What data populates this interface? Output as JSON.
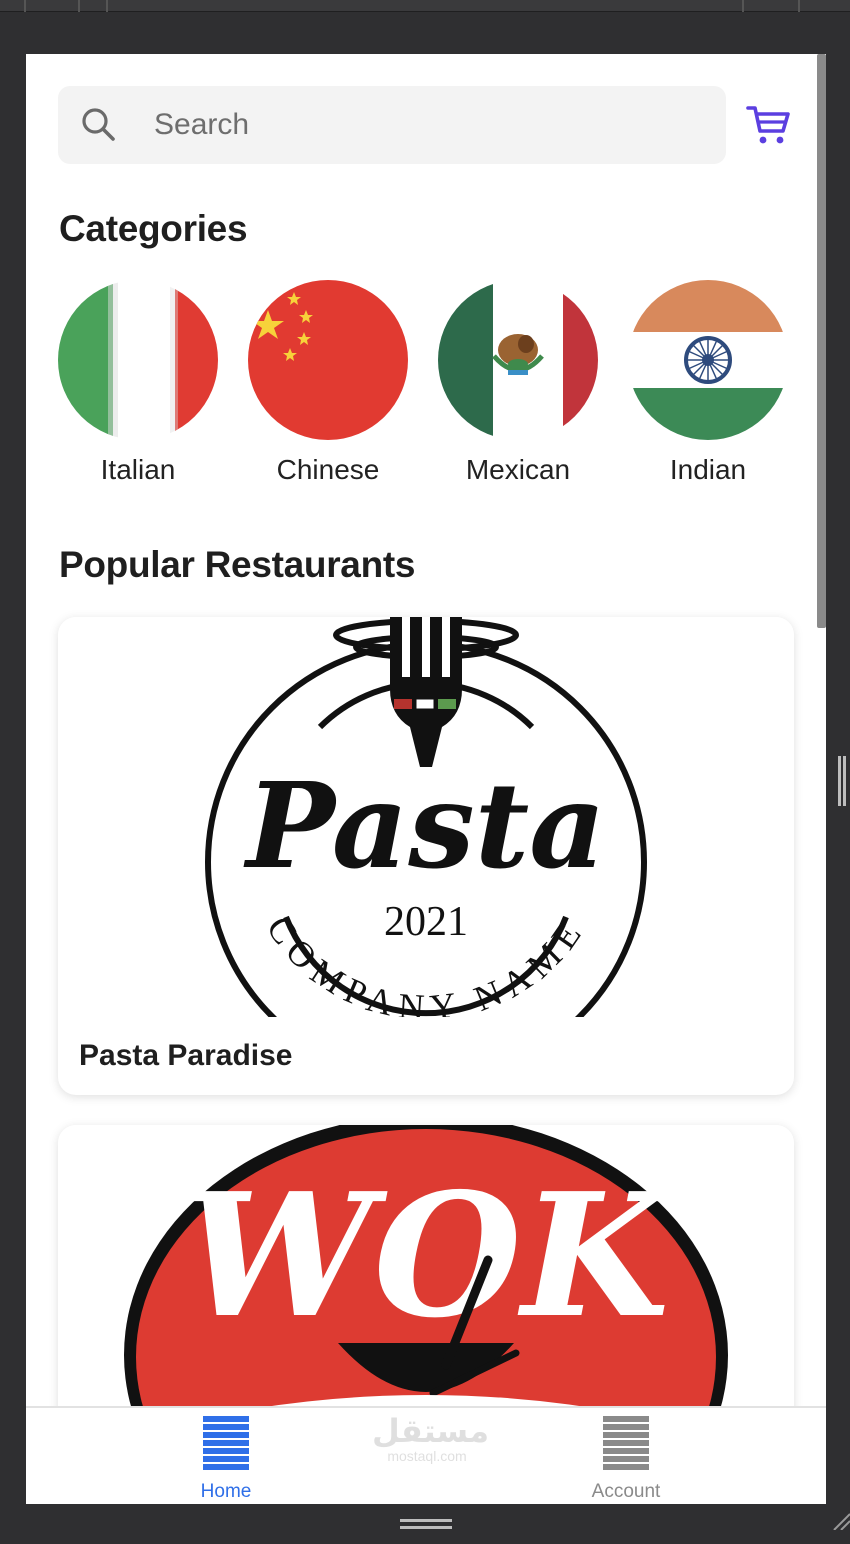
{
  "search": {
    "placeholder": "Search",
    "value": ""
  },
  "cart": {
    "icon": "cart-icon",
    "color": "#5b3fe0"
  },
  "categories": {
    "heading": "Categories",
    "items": [
      {
        "label": "Italian",
        "icon": "italy-flag-icon"
      },
      {
        "label": "Chinese",
        "icon": "china-flag-icon"
      },
      {
        "label": "Mexican",
        "icon": "mexico-flag-icon"
      },
      {
        "label": "Indian",
        "icon": "india-flag-icon"
      }
    ]
  },
  "popular": {
    "heading": "Popular Restaurants",
    "restaurants": [
      {
        "name": "Pasta Paradise",
        "logo": {
          "script": "Pasta",
          "year": "2021",
          "arc_text": "COMPANY NAME"
        }
      },
      {
        "name": "",
        "logo": {
          "script": "WOK"
        }
      }
    ]
  },
  "tabbar": {
    "home_label": "Home",
    "account_label": "Account",
    "active_color": "#2f6fe8",
    "inactive_color": "#8a8a8a"
  },
  "watermark": {
    "arabic": "مستقل",
    "latin": "mostaql.com"
  }
}
